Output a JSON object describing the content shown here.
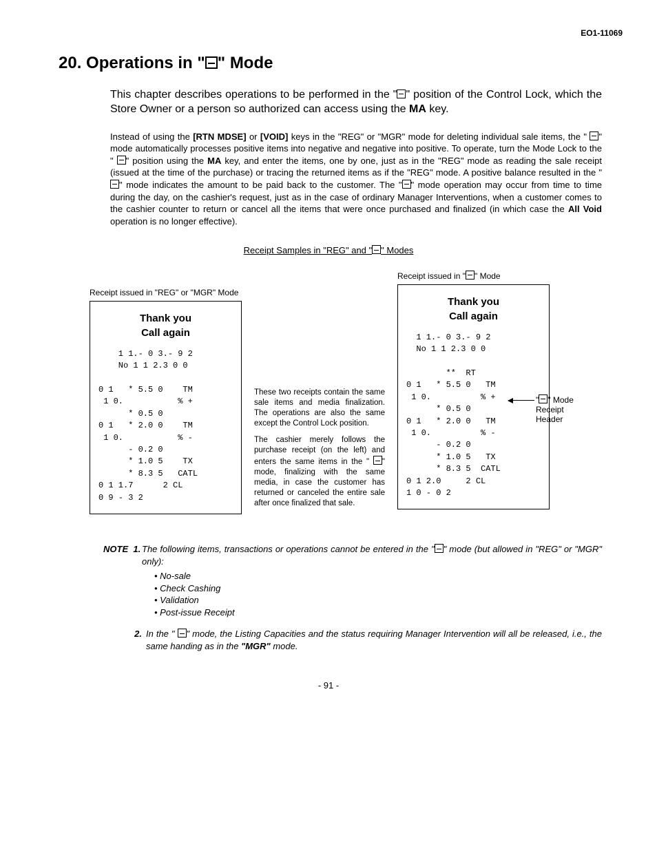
{
  "page_id": "EO1-11069",
  "title_prefix": "20. Operations in \"",
  "title_suffix": "\" Mode",
  "intro": {
    "t1": "This chapter describes operations to be performed in the \"",
    "t2": "\" position of the Control Lock, which the Store Owner or a person so authorized can access using the ",
    "t3": "MA",
    "t4": " key."
  },
  "body": {
    "p1a": "Instead of using the ",
    "p1b": "[RTN MDSE]",
    "p1c": " or ",
    "p1d": "[VOID]",
    "p1e": " keys in the \"REG\" or \"MGR\" mode for deleting individual sale items, the \" ",
    "p1f": "\" mode automatically processes positive items into negative and negative into positive. To operate, turn the Mode Lock to the \" ",
    "p1g": "\" position using the ",
    "p1h": "MA",
    "p1i": " key, and enter the items, one by one, just as in the \"REG\" mode as reading the sale receipt (issued at the time of the purchase) or tracing the returned items as if the \"REG\" mode. A positive balance resulted in the \" ",
    "p1j": "\" mode indicates the amount to be paid back to the customer. The \"",
    "p1k": "\" mode operation may occur from time to time during the day, on the cashier's request, just as in the case of ordinary Manager Interventions, when a customer comes to the cashier counter to return or cancel all the items that were once purchased and finalized (in which case the ",
    "p1l": "All Void",
    "p1m": " operation is no longer effective)."
  },
  "samples_title_a": "Receipt Samples in \"REG\" and \"",
  "samples_title_b": "\" Modes",
  "receipt_left": {
    "label": "Receipt issued in \"REG\" or \"MGR\" Mode",
    "thanks1": "Thank you",
    "thanks2": "Call  again",
    "lines": [
      "    1 1.- 0 3.- 9 2",
      "    No 1 1 2.3 0 0",
      "",
      "0 1   * 5.5 0    TM",
      " 1 0.           % +",
      "      * 0.5 0",
      "0 1   * 2.0 0    TM",
      " 1 0.           % -",
      "      - 0.2 0",
      "      * 1.0 5    TX",
      "      * 8.3 5   CATL",
      "0 1 1.7      2 CL",
      "0 9 - 3 2"
    ]
  },
  "mid": {
    "p1": "These two receipts contain the same sale items and media finalization. The operations are also the same except the Control Lock position.",
    "p2a": "The cashier merely follows the purchase receipt (on the left) and enters the same items in the \" ",
    "p2b": "\" mode, finalizing with the same media, in case the customer has returned or canceled the entire sale after once finalized that sale."
  },
  "receipt_right": {
    "label_a": "Receipt issued in \"",
    "label_b": "\" Mode",
    "thanks1": "Thank you",
    "thanks2": "Call  again",
    "lines": [
      "  1 1.- 0 3.- 9 2",
      "  No 1 1 2.3 0 0",
      "",
      "        **  RT",
      "0 1   * 5.5 0   TM",
      " 1 0.          % +",
      "      * 0.5 0",
      "0 1   * 2.0 0   TM",
      " 1 0.          % -",
      "      - 0.2 0",
      "      * 1.0 5   TX",
      "      * 8.3 5  CATL",
      "0 1 2.0     2 CL",
      "1 0 - 0 2"
    ]
  },
  "annot": {
    "l1": "\"",
    "l2": "\" Mode",
    "l3": "Receipt",
    "l4": "Header"
  },
  "notes": {
    "head": "NOTE",
    "n1_label": "1.",
    "n1a": "The following items, transactions or operations cannot be entered in the \"",
    "n1b": "\" mode (but allowed in \"REG\" or \"MGR\" only):",
    "bullets": [
      "No-sale",
      "Check Cashing",
      "Validation",
      "Post-issue Receipt"
    ],
    "n2_label": "2.",
    "n2a": "In the \" ",
    "n2b": "\" mode, the Listing Capacities and the status requiring Manager Intervention will all be released, i.e., the same handing as in the ",
    "n2c": "\"MGR\"",
    "n2d": " mode."
  },
  "page_num": "- 91 -"
}
